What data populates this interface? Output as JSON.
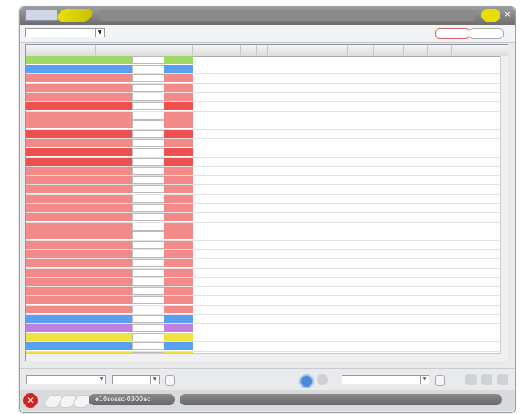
{
  "window": {
    "title": "",
    "close_label": "×"
  },
  "toolbar": {
    "filter_value": "",
    "btn_a": "",
    "btn_b": ""
  },
  "grid": {
    "columns": [
      "",
      "",
      "",
      "",
      "",
      "",
      "",
      "",
      "",
      "",
      "",
      "",
      "",
      ""
    ],
    "rows": [
      {
        "bg": "#9fd865",
        "c": [
          "",
          "",
          "",
          "",
          "",
          "",
          "",
          "",
          "",
          "",
          "",
          "",
          "",
          ""
        ]
      },
      {
        "bg": "#5aa0f0",
        "c": [
          "",
          "",
          "",
          "",
          "",
          "",
          "",
          "",
          "",
          "",
          "",
          "",
          "",
          ""
        ]
      },
      {
        "bg": "#f28a8a",
        "c": [
          "",
          "",
          "",
          "",
          "",
          "",
          "",
          "",
          "",
          "",
          "",
          "",
          "",
          ""
        ]
      },
      {
        "bg": "#f28a8a",
        "c": [
          "",
          "",
          "",
          "",
          "",
          "",
          "",
          "",
          "",
          "",
          "",
          "",
          "",
          ""
        ]
      },
      {
        "bg": "#f28a8a",
        "c": [
          "",
          "",
          "",
          "",
          "",
          "",
          "",
          "",
          "",
          "",
          "",
          "",
          "",
          ""
        ]
      },
      {
        "bg": "#ee5050",
        "c": [
          "",
          "",
          "",
          "",
          "",
          "",
          "",
          "",
          "",
          "",
          "",
          "",
          "",
          ""
        ]
      },
      {
        "bg": "#f28a8a",
        "c": [
          "",
          "",
          "",
          "",
          "",
          "",
          "",
          "",
          "",
          "",
          "",
          "",
          "",
          ""
        ]
      },
      {
        "bg": "#f28a8a",
        "c": [
          "",
          "",
          "",
          "",
          "",
          "",
          "",
          "",
          "",
          "",
          "",
          "",
          "",
          ""
        ]
      },
      {
        "bg": "#ee5050",
        "c": [
          "",
          "",
          "",
          "",
          "",
          "",
          "",
          "",
          "",
          "",
          "",
          "",
          "",
          ""
        ]
      },
      {
        "bg": "#f28a8a",
        "c": [
          "",
          "",
          "",
          "",
          "",
          "",
          "",
          "",
          "",
          "",
          "",
          "",
          "",
          ""
        ]
      },
      {
        "bg": "#ee5050",
        "c": [
          "",
          "",
          "",
          "",
          "",
          "",
          "",
          "",
          "",
          "",
          "",
          "",
          "",
          ""
        ]
      },
      {
        "bg": "#ee5050",
        "c": [
          "",
          "",
          "",
          "",
          "",
          "",
          "",
          "",
          "",
          "",
          "",
          "",
          "",
          ""
        ]
      },
      {
        "bg": "#f28a8a",
        "c": [
          "",
          "",
          "",
          "",
          "",
          "",
          "",
          "",
          "",
          "",
          "",
          "",
          "",
          ""
        ]
      },
      {
        "bg": "#f28a8a",
        "c": [
          "",
          "",
          "",
          "",
          "",
          "",
          "",
          "",
          "",
          "",
          "",
          "",
          "",
          ""
        ]
      },
      {
        "bg": "#f28a8a",
        "c": [
          "",
          "",
          "",
          "",
          "",
          "",
          "",
          "",
          "",
          "",
          "",
          "",
          "",
          ""
        ]
      },
      {
        "bg": "#f28a8a",
        "c": [
          "",
          "",
          "",
          "",
          "",
          "",
          "",
          "",
          "",
          "",
          "",
          "",
          "",
          ""
        ]
      },
      {
        "bg": "#f28a8a",
        "c": [
          "",
          "",
          "",
          "",
          "",
          "",
          "",
          "",
          "",
          "",
          "",
          "",
          "",
          ""
        ]
      },
      {
        "bg": "#f28a8a",
        "c": [
          "",
          "",
          "",
          "",
          "",
          "",
          "",
          "",
          "",
          "",
          "",
          "",
          "",
          ""
        ]
      },
      {
        "bg": "#f28a8a",
        "c": [
          "",
          "",
          "",
          "",
          "",
          "",
          "",
          "",
          "",
          "",
          "",
          "",
          "",
          ""
        ]
      },
      {
        "bg": "#f28a8a",
        "c": [
          "",
          "",
          "",
          "",
          "",
          "",
          "",
          "",
          "",
          "",
          "",
          "",
          "",
          ""
        ]
      },
      {
        "bg": "#f28a8a",
        "c": [
          "",
          "",
          "",
          "",
          "",
          "",
          "",
          "",
          "",
          "",
          "",
          "",
          "",
          ""
        ]
      },
      {
        "bg": "#f28a8a",
        "c": [
          "",
          "",
          "",
          "",
          "",
          "",
          "",
          "",
          "",
          "",
          "",
          "",
          "",
          ""
        ]
      },
      {
        "bg": "#f28a8a",
        "c": [
          "",
          "",
          "",
          "",
          "",
          "",
          "",
          "",
          "",
          "",
          "",
          "",
          "",
          ""
        ]
      },
      {
        "bg": "#f28a8a",
        "c": [
          "",
          "",
          "",
          "",
          "",
          "",
          "",
          "",
          "",
          "",
          "",
          "",
          "",
          ""
        ]
      },
      {
        "bg": "#f28a8a",
        "c": [
          "",
          "",
          "",
          "",
          "",
          "",
          "",
          "",
          "",
          "",
          "",
          "",
          "",
          ""
        ]
      },
      {
        "bg": "#f28a8a",
        "c": [
          "",
          "",
          "",
          "",
          "",
          "",
          "",
          "",
          "",
          "",
          "",
          "",
          "",
          ""
        ]
      },
      {
        "bg": "#f28a8a",
        "c": [
          "",
          "",
          "",
          "",
          "",
          "",
          "",
          "",
          "",
          "",
          "",
          "",
          "",
          ""
        ]
      },
      {
        "bg": "#f28a8a",
        "c": [
          "",
          "",
          "",
          "",
          "",
          "",
          "",
          "",
          "",
          "",
          "",
          "",
          "",
          ""
        ]
      },
      {
        "bg": "#5aa0f0",
        "c": [
          "",
          "",
          "",
          "",
          "",
          "",
          "",
          "",
          "",
          "",
          "",
          "",
          "",
          ""
        ]
      },
      {
        "bg": "#c080e0",
        "c": [
          "",
          "",
          "",
          "",
          "",
          "",
          "",
          "",
          "",
          "",
          "",
          "",
          "",
          ""
        ]
      },
      {
        "bg": "#f0e040",
        "c": [
          "",
          "",
          "",
          "",
          "",
          "",
          "",
          "",
          "",
          "",
          "",
          "",
          "",
          ""
        ]
      },
      {
        "bg": "#5aa0f0",
        "c": [
          "",
          "",
          "",
          "",
          "",
          "",
          "",
          "",
          "",
          "",
          "",
          "",
          "",
          ""
        ]
      },
      {
        "bg": "#f0e040",
        "c": [
          "",
          "",
          "",
          "",
          "",
          "",
          "",
          "",
          "",
          "",
          "",
          "",
          "",
          ""
        ]
      },
      {
        "bg": "#f0e040",
        "c": [
          "",
          "",
          "",
          "",
          "",
          "",
          "",
          "",
          "",
          "",
          "",
          "",
          "",
          ""
        ]
      },
      {
        "bg": "#5aa0f0",
        "c": [
          "",
          "",
          "",
          "",
          "",
          "",
          "",
          "",
          "",
          "",
          "",
          "",
          "",
          ""
        ]
      },
      {
        "bg": "#f0e040",
        "c": [
          "",
          "",
          "",
          "",
          "",
          "",
          "",
          "",
          "",
          "",
          "",
          "",
          "",
          ""
        ]
      }
    ]
  },
  "bottom": {
    "team_select": "",
    "second_select": "",
    "refresh_label": "",
    "view_select": "",
    "apply_label": ""
  },
  "status": {
    "host_name": "e10sossc-0300ac",
    "message": ""
  }
}
